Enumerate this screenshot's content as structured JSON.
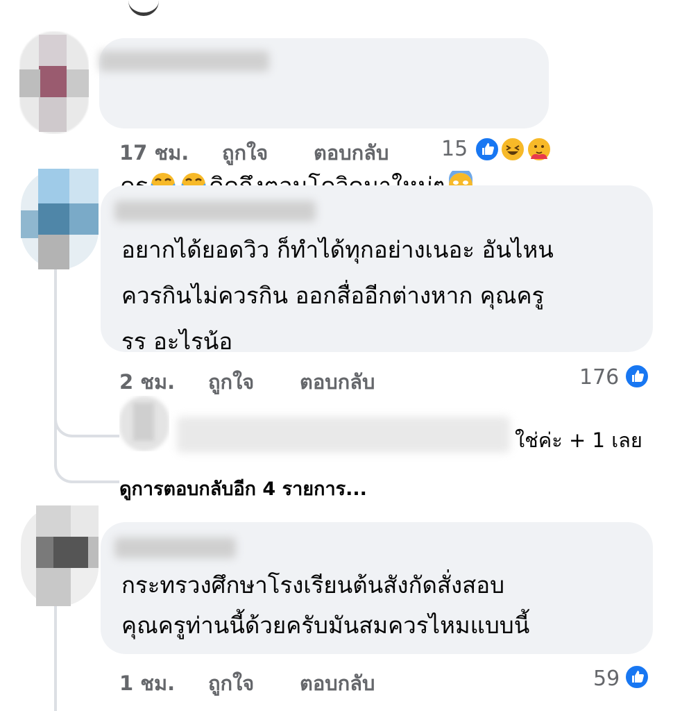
{
  "comments": [
    {
      "text": "ครู",
      "text_after_emoji": "คิดถึงตอนโควิดมาใหม่ๆ",
      "time": "17 ชม.",
      "like_label": "ถูกใจ",
      "reply_label": "ตอบกลับ",
      "reaction_count": "15",
      "reactions": [
        "like-icon",
        "laughing-face-icon",
        "care-hug-icon"
      ],
      "inline_emojis": [
        "tears-of-joy-icon",
        "tears-of-joy-icon",
        "screaming-fear-icon"
      ]
    },
    {
      "text": "อยากได้ยอดวิว ก็ทำได้ทุกอย่างเนอะ อันไหน\nควรกินไม่ควรกิน ออกสื่ออีกต่างหาก คุณครู\nรร อะไรน้อ",
      "time": "2 ชม.",
      "like_label": "ถูกใจ",
      "reply_label": "ตอบกลับ",
      "reaction_count": "176",
      "reactions": [
        "like-icon"
      ]
    },
    {
      "text": "กระทรวงศึกษาโรงเรียนต้นสังกัดสั่งสอบ\nคุณครูท่านนี้ด้วยครับมันสมควรไหมแบบนี้",
      "time": "1 ชม.",
      "like_label": "ถูกใจ",
      "reply_label": "ตอบกลับ",
      "reaction_count": "59",
      "reactions": [
        "like-icon"
      ]
    }
  ],
  "reply_preview": {
    "text": "ใช่ค่ะ + 1 เลย"
  },
  "view_more_replies": "ดูการตอบกลับอีก 4 รายการ...",
  "colors": {
    "bubble": "#f0f2f5",
    "meta_text": "#65676b",
    "like_blue": "#1877f2",
    "thread_line": "#dcdfe4"
  }
}
